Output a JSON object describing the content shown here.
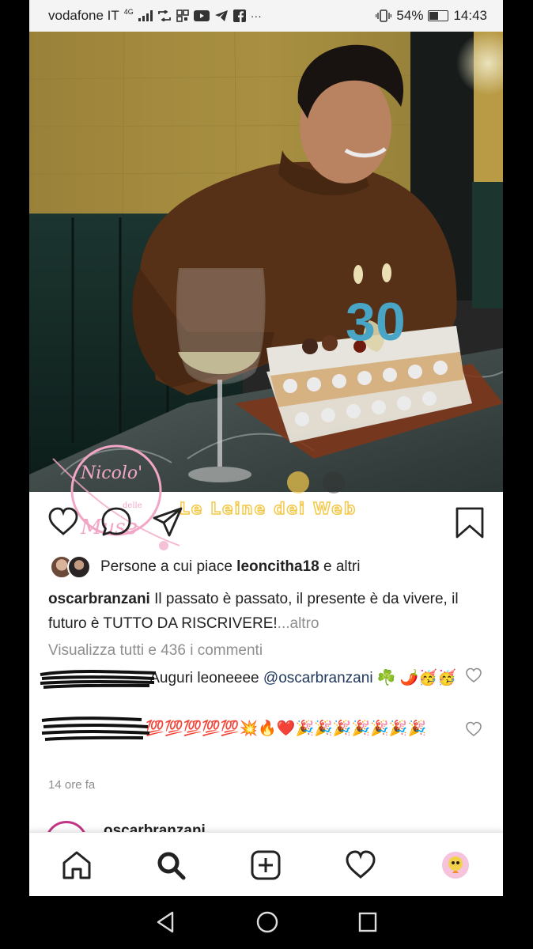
{
  "status_bar": {
    "carrier": "vodafone IT",
    "network": "4G",
    "battery": "54%",
    "time": "14:43",
    "more": "···"
  },
  "post": {
    "cake_number": "30",
    "liked_by_prefix": "Persone a cui piace",
    "liked_by_user": "leoncitha18",
    "liked_by_suffix": "e altri",
    "caption_user": "oscarbranzani",
    "caption_text": "Il passato è passato, il presente è da vivere, il futuro è TUTTO DA RISCRIVERE!",
    "caption_more": "...altro",
    "view_comments": "Visualizza tutti e 436 i commenti",
    "comments": [
      {
        "user": "",
        "text": "Auguri leoneeee",
        "mention": "@oscarbranzani",
        "emoji": "☘️ 🌶️🥳🥳"
      },
      {
        "user": "",
        "text": "",
        "emoji": "💯💯💯💯💯💥🔥❤️🎉🎉🎉🎉🎉🎉🎉"
      }
    ],
    "time_ago": "14 ore fa"
  },
  "next_post": {
    "user": "oscarbranzani"
  },
  "watermarks": {
    "left_mark": "Nicolo' delle Muse",
    "center_mark": "Le Leine dei Web"
  },
  "colors": {
    "text": "#222222",
    "secondary": "#8e8e8e",
    "mention": "#20385e",
    "candle": "#4fb3d6",
    "watermark_pink": "#f2a6c6",
    "watermark_yellow": "#f3c94b"
  },
  "icons": {
    "like": "heart-outline-icon",
    "comment": "comment-bubble-icon",
    "share": "paper-plane-icon",
    "save": "bookmark-icon",
    "home": "home-icon",
    "search": "search-icon",
    "add": "plus-square-icon",
    "activity": "heart-icon",
    "profile": "profile-avatar"
  }
}
